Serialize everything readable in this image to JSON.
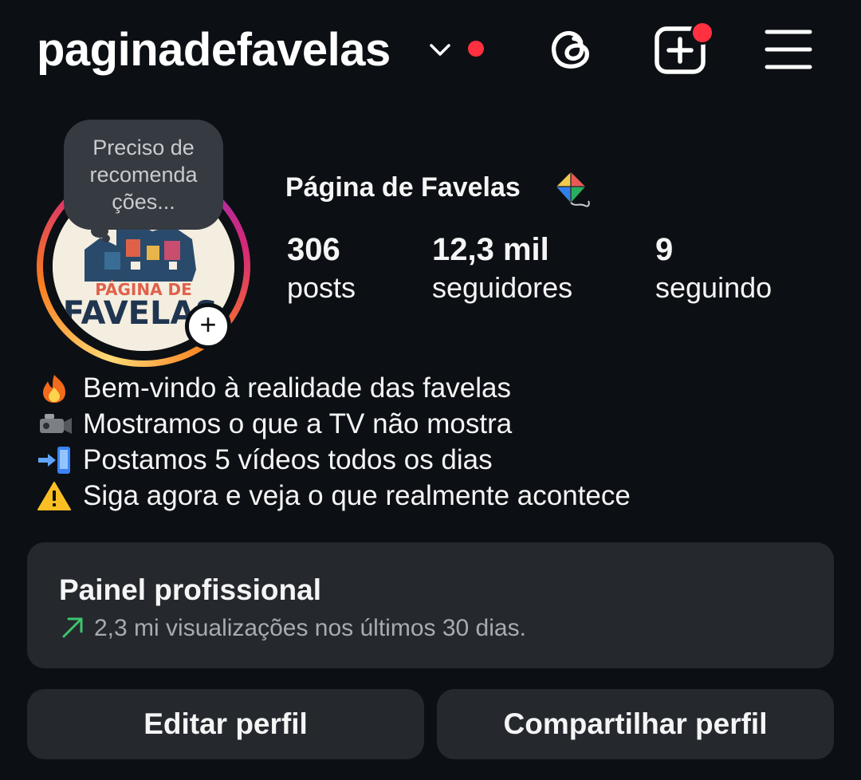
{
  "header": {
    "username": "paginadefavelas",
    "icons": [
      "chevron-down-icon",
      "notification-dot",
      "threads-icon",
      "create-post-icon",
      "hamburger-menu-icon"
    ],
    "accent_color": "#ff3040"
  },
  "profile": {
    "note": [
      "Preciso de",
      "recomenda",
      "ções..."
    ],
    "avatar_text": [
      "PÁGINA DE",
      "FAVELAS"
    ],
    "full_name": "Página de Favelas",
    "stats": [
      {
        "value": "306",
        "label": "posts"
      },
      {
        "value": "12,3 mil",
        "label": "seguidores"
      },
      {
        "value": "9",
        "label": "seguindo"
      }
    ]
  },
  "bio": [
    {
      "icon": "fire-emoji-icon",
      "text": "Bem-vindo à realidade das favelas"
    },
    {
      "icon": "video-camera-emoji-icon",
      "text": "Mostramos o que a TV não mostra"
    },
    {
      "icon": "phone-arrow-emoji-icon",
      "text": "Postamos 5 vídeos todos os dias"
    },
    {
      "icon": "warning-emoji-icon",
      "text": "Siga agora e veja o que realmente acontece"
    }
  ],
  "dashboard": {
    "title": "Painel profissional",
    "subtitle": "2,3 mi visualizações nos últimos 30 dias.",
    "trend_color": "#3ec46d"
  },
  "buttons": {
    "edit": "Editar perfil",
    "share": "Compartilhar perfil"
  }
}
